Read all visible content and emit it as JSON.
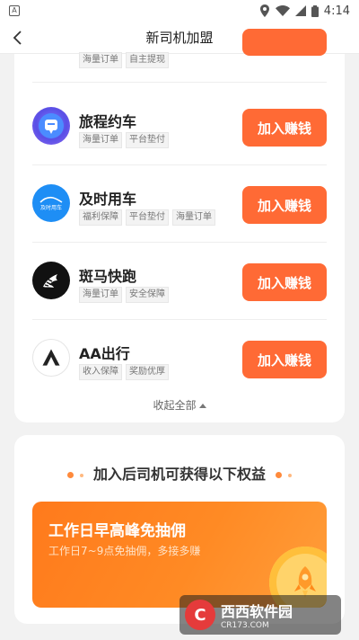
{
  "status_bar": {
    "app_glyph": "A",
    "time": "4:14",
    "icons": [
      "location-icon",
      "wifi-icon",
      "signal-icon",
      "battery-icon"
    ]
  },
  "nav": {
    "title": "新司机加盟",
    "back_icon": "chevron-left-icon"
  },
  "partial_row": {
    "tags": [
      "海量订单",
      "自主提现"
    ]
  },
  "platforms": [
    {
      "name": "旅程约车",
      "tags": [
        "海量订单",
        "平台垫付"
      ],
      "button": "加入赚钱",
      "logo": "lvcheng-logo"
    },
    {
      "name": "及时用车",
      "tags": [
        "福利保障",
        "平台垫付",
        "海量订单"
      ],
      "button": "加入赚钱",
      "logo": "jishi-logo",
      "logo_text": "及时用车"
    },
    {
      "name": "斑马快跑",
      "tags": [
        "海量订单",
        "安全保障"
      ],
      "button": "加入赚钱",
      "logo": "zebra-logo"
    },
    {
      "name": "AA出行",
      "tags": [
        "收入保障",
        "奖励优厚"
      ],
      "button": "加入赚钱",
      "logo": "aa-logo"
    }
  ],
  "collapse_label": "收起全部",
  "benefits": {
    "title": "加入后司机可获得以下权益",
    "banner_title": "工作日早高峰免抽佣",
    "banner_subtitle": "工作日7~9点免抽佣，多接多赚"
  },
  "watermark": {
    "logo_letter": "C",
    "main": "西西软件园",
    "sub": "CR173.COM"
  },
  "colors": {
    "accent": "#ff6a35",
    "banner": "#ff8a24"
  }
}
